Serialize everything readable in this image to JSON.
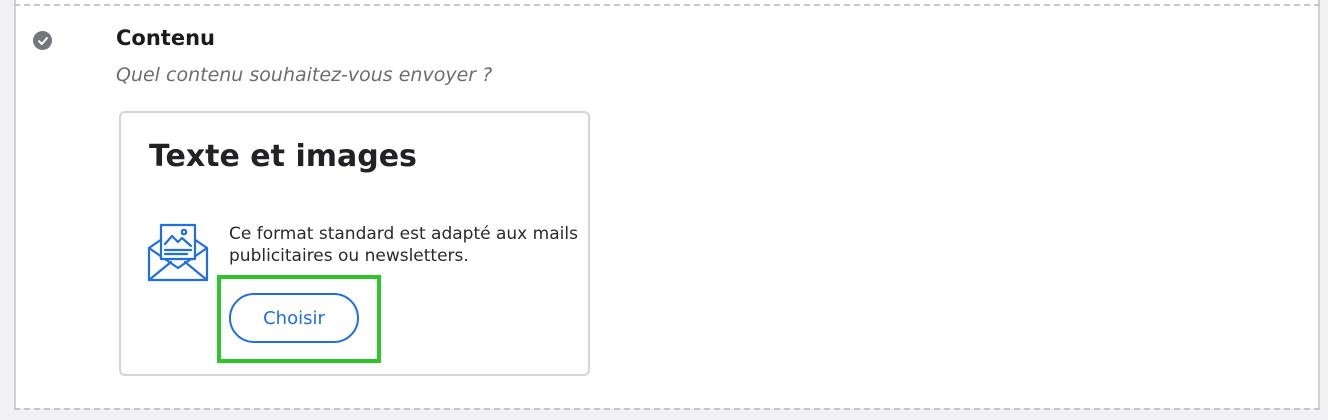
{
  "step": {
    "status": "check-icon",
    "title": "Contenu",
    "subtitle": "Quel contenu souhaitez-vous envoyer ?"
  },
  "option_card": {
    "title": "Texte et images",
    "icon": "envelope-image-icon",
    "description": "Ce format standard est adapté aux mails publicitaires ou newsletters.",
    "button_label": "Choisir"
  },
  "colors": {
    "accent": "#1f6fe0",
    "highlight": "#2ec52a",
    "check": "#75757d"
  }
}
